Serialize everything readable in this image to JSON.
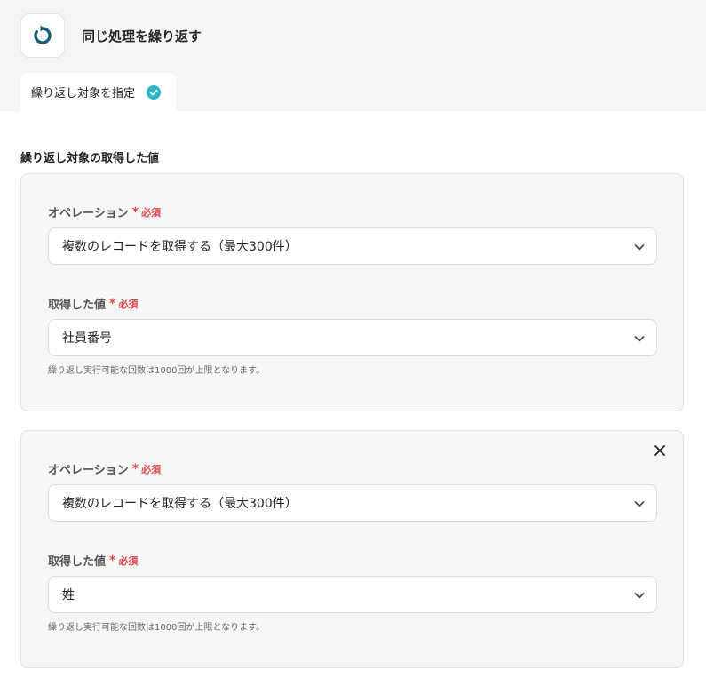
{
  "header": {
    "title": "同じ処理を繰り返す",
    "icon": "loop-icon",
    "icon_color": "#1a5f7a"
  },
  "tab": {
    "label": "繰り返し対象を指定",
    "status_icon": "check-circle-icon",
    "status_color": "#2ab7ca"
  },
  "section": {
    "title": "繰り返し対象の取得した値"
  },
  "cards": [
    {
      "operation_label": "オペレーション",
      "required_star": "*",
      "required_text": "必須",
      "operation_value": "複数のレコードを取得する（最大300件）",
      "value_label": "取得した値",
      "value_value": "社員番号",
      "hint": "繰り返し実行可能な回数は1000回が上限となります。"
    },
    {
      "operation_label": "オペレーション",
      "required_star": "*",
      "required_text": "必須",
      "operation_value": "複数のレコードを取得する（最大300件）",
      "value_label": "取得した値",
      "value_value": "姓",
      "hint": "繰り返し実行可能な回数は1000回が上限となります。"
    }
  ]
}
